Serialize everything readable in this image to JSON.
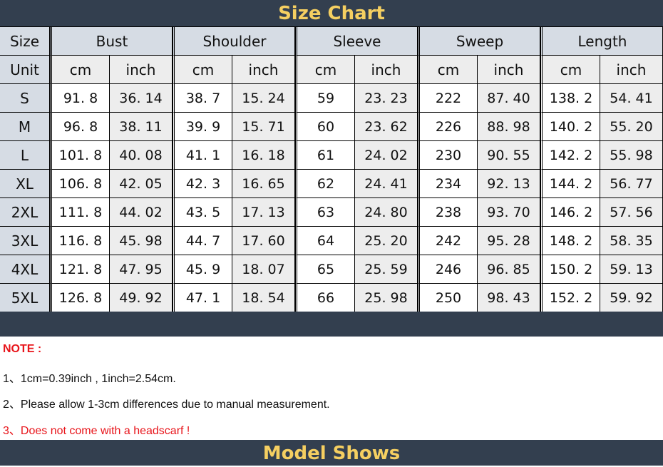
{
  "title": "Size Chart",
  "headers": [
    "Size",
    "Bust",
    "Shoulder",
    "Sleeve",
    "Sweep",
    "Length"
  ],
  "unit_label": "Unit",
  "units": [
    "cm",
    "inch"
  ],
  "rows": [
    [
      "S",
      "91. 8",
      "36. 14",
      "38. 7",
      "15. 24",
      "59",
      "23. 23",
      "222",
      "87. 40",
      "138. 2",
      "54. 41"
    ],
    [
      "M",
      "96. 8",
      "38. 11",
      "39. 9",
      "15. 71",
      "60",
      "23. 62",
      "226",
      "88. 98",
      "140. 2",
      "55. 20"
    ],
    [
      "L",
      "101. 8",
      "40. 08",
      "41. 1",
      "16. 18",
      "61",
      "24. 02",
      "230",
      "90. 55",
      "142. 2",
      "55. 98"
    ],
    [
      "XL",
      "106. 8",
      "42. 05",
      "42. 3",
      "16. 65",
      "62",
      "24. 41",
      "234",
      "92. 13",
      "144. 2",
      "56. 77"
    ],
    [
      "2XL",
      "111. 8",
      "44. 02",
      "43. 5",
      "17. 13",
      "63",
      "24. 80",
      "238",
      "93. 70",
      "146. 2",
      "57. 56"
    ],
    [
      "3XL",
      "116. 8",
      "45. 98",
      "44. 7",
      "17. 60",
      "64",
      "25. 20",
      "242",
      "95. 28",
      "148. 2",
      "58. 35"
    ],
    [
      "4XL",
      "121. 8",
      "47. 95",
      "45. 9",
      "18. 07",
      "65",
      "25. 59",
      "246",
      "96. 85",
      "150. 2",
      "59. 13"
    ],
    [
      "5XL",
      "126. 8",
      "49. 92",
      "47. 1",
      "18. 54",
      "66",
      "25. 98",
      "250",
      "98. 43",
      "152. 2",
      "59. 92"
    ]
  ],
  "notes": {
    "heading": "NOTE :",
    "items": [
      "1、1cm=0.39inch , 1inch=2.54cm.",
      "2、Please allow 1-3cm differences due to manual measurement.",
      "3、Does not come with a headscarf !"
    ]
  },
  "model_title": "Model Shows",
  "colors": {
    "bar": "#333f4f",
    "gold": "#f5cf61",
    "header": "#d6dce4",
    "alt": "#ededed",
    "red": "#e8141a"
  }
}
